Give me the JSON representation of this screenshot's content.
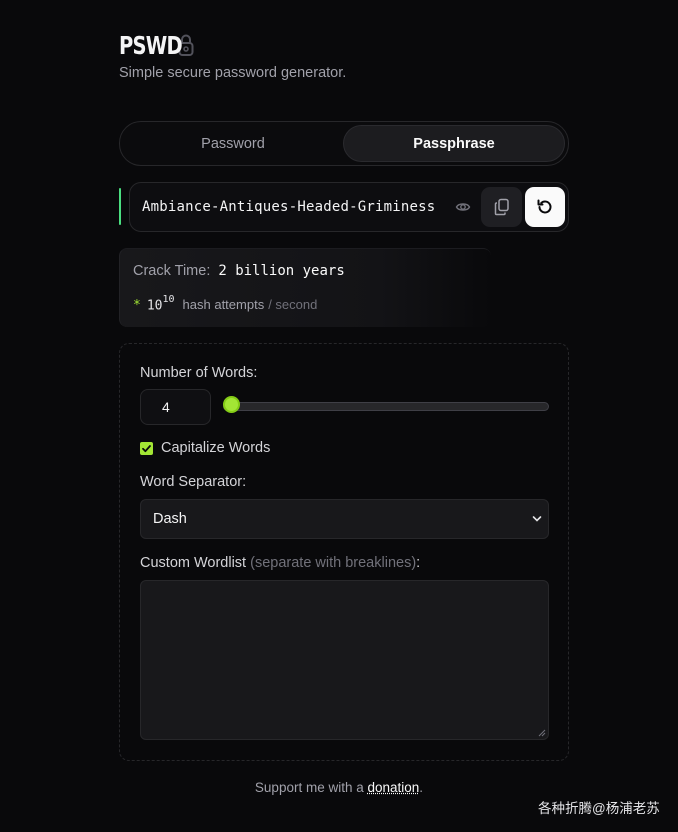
{
  "header": {
    "logo_text": "PSWD",
    "logo_icon": "lock-icon",
    "subtitle": "Simple secure password generator."
  },
  "tabs": [
    {
      "label": "Password",
      "active": false
    },
    {
      "label": "Passphrase",
      "active": true
    }
  ],
  "output": {
    "passphrase": "Ambiance-Antiques-Headed-Griminess",
    "icons": [
      "eye-icon",
      "copy-icon",
      "refresh-icon"
    ]
  },
  "crack": {
    "label": "Crack Time:",
    "value": "2 billion years",
    "asterisk": "*",
    "base": "10",
    "exponent": "10",
    "hash_label": "hash attempts",
    "per_second": "/ second"
  },
  "settings": {
    "words_label": "Number of Words:",
    "words_value": "4",
    "slider_fraction": 0.0,
    "capitalize_label": "Capitalize Words",
    "capitalize_checked": true,
    "separator_label": "Word Separator:",
    "separator_value": "Dash",
    "wordlist_label": "Custom Wordlist",
    "wordlist_hint": "(separate with breaklines)",
    "wordlist_colon": ":",
    "wordlist_value": ""
  },
  "footer": {
    "prefix": "Support me with a ",
    "link": "donation",
    "suffix": "."
  },
  "watermark": "各种折腾@杨浦老苏",
  "colors": {
    "background": "#09090b",
    "accent": "#a3e635",
    "accent_bar": "#4ade80"
  }
}
